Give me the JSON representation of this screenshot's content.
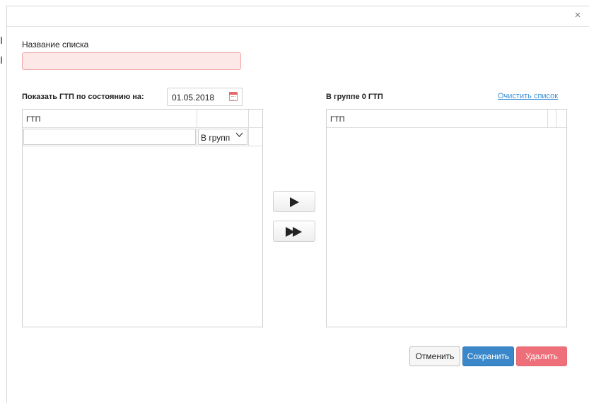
{
  "dialog": {
    "close_symbol": "×"
  },
  "form": {
    "name_label": "Название списка",
    "name_value": "",
    "name_placeholder": ""
  },
  "left_panel": {
    "date_label": "Показать ГТП по состоянию на:",
    "date_value": "01.05.2018",
    "grid_header": "ГТП",
    "filter_value": "",
    "filter_select": "В групп"
  },
  "right_panel": {
    "title": "В группе 0 ГТП",
    "clear_link": "Очистить список",
    "grid_header": "ГТП"
  },
  "buttons": {
    "cancel": "Отменить",
    "save": "Сохранить",
    "delete": "Удалить"
  },
  "icons": {
    "close": "close-icon",
    "calendar": "calendar-icon",
    "dropdown": "chevron-down-icon",
    "move_one": "play-icon",
    "move_all": "fast-forward-icon"
  },
  "colors": {
    "save_button": "#3a87c9",
    "delete_button": "#ee6f79",
    "link": "#3d8fd8",
    "invalid_field": "#fde8e8"
  }
}
